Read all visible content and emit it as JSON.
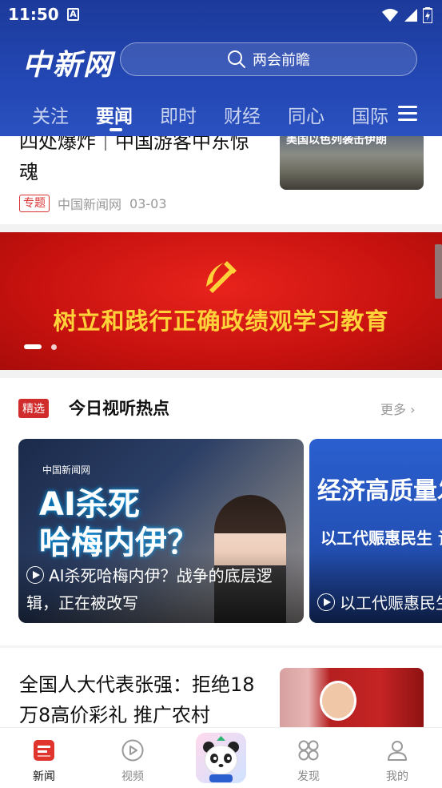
{
  "status_bar": {
    "time": "11:50",
    "notif_icon_letter": "A"
  },
  "header": {
    "logo": "中新网",
    "search_placeholder": "两会前瞻",
    "tabs": [
      "关注",
      "要闻",
      "即时",
      "财经",
      "同心",
      "国际"
    ],
    "active_tab": "要闻"
  },
  "top_article": {
    "title": "四处爆炸｜中国游客中东惊魂",
    "tag": "专题",
    "source": "中国新闻网",
    "date": "03-03",
    "thumb_caption": "美国以色列袭击伊朗"
  },
  "banner": {
    "text": "树立和践行正确政绩观学习教育",
    "slide_count": 2,
    "active_slide": 1
  },
  "section": {
    "badge": "精选",
    "title": "今日视听热点",
    "more": "更多"
  },
  "videos": [
    {
      "overlay_logo": "中国新闻网",
      "overlay_title": "AI杀死\n哈梅内伊？",
      "caption": "AI杀死哈梅内伊？战争的底层逻辑，正在被改写"
    },
    {
      "overlay_title": "经济高质量发展",
      "overlay_sub": "以工代赈惠民生 让",
      "caption": "以工代赈惠民生 让钱袋子”鼓起来"
    }
  ],
  "bottom_article": {
    "title": "全国人大代表张强：拒绝18万8高价彩礼 推广农村"
  },
  "bottom_nav": [
    {
      "label": "新闻",
      "icon": "news-icon",
      "active": true
    },
    {
      "label": "视频",
      "icon": "video-icon",
      "active": false
    },
    {
      "label": "",
      "icon": "panda-icon",
      "active": false
    },
    {
      "label": "发现",
      "icon": "discover-icon",
      "active": false
    },
    {
      "label": "我的",
      "icon": "profile-icon",
      "active": false
    }
  ],
  "colors": {
    "header_blue": "#2347b4",
    "banner_red": "#c8120f",
    "banner_text": "#ffd23a",
    "tag_red": "#d12c2c"
  }
}
